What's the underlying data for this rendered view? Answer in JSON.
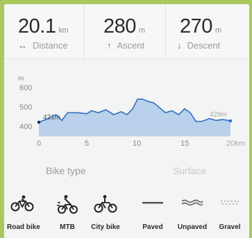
{
  "stats": {
    "distance": {
      "value": "20.1",
      "unit": "km",
      "label": "Distance",
      "icon": "↔"
    },
    "ascent": {
      "value": "280",
      "unit": "m",
      "label": "Ascent",
      "icon": "↑"
    },
    "descent": {
      "value": "270",
      "unit": "m",
      "label": "Descent",
      "icon": "↓"
    }
  },
  "chart_data": {
    "type": "area",
    "ylabel": "m",
    "xlim": [
      0,
      20
    ],
    "ylim": [
      350,
      650
    ],
    "yticks": [
      "600",
      "500",
      "400"
    ],
    "xticks": [
      "0",
      "5",
      "10",
      "15",
      "20km"
    ],
    "start_label": "421m",
    "end_label": "428m",
    "x": [
      0,
      1,
      1.8,
      2.4,
      3.0,
      4.0,
      5.0,
      5.5,
      6.2,
      7.0,
      7.8,
      8.6,
      9.2,
      9.8,
      10.3,
      10.8,
      11.3,
      12.0,
      12.5,
      13.2,
      13.9,
      14.6,
      15.2,
      15.8,
      16.4,
      17.0,
      17.8,
      18.5,
      19.2,
      20.0
    ],
    "y": [
      421,
      440,
      460,
      430,
      470,
      470,
      465,
      480,
      470,
      485,
      460,
      475,
      460,
      490,
      540,
      540,
      530,
      520,
      500,
      470,
      480,
      460,
      490,
      470,
      425,
      425,
      440,
      430,
      435,
      428
    ],
    "colors": {
      "line": "#2d6fc0",
      "fill": "#b9d1ea",
      "marker": "#1e2a4a"
    }
  },
  "sections": {
    "bike_type": "Bike type",
    "surface": "Surface"
  },
  "bike_types": [
    {
      "label": "Road bike",
      "icon": "road-bike-icon"
    },
    {
      "label": "MTB",
      "icon": "mtb-icon"
    },
    {
      "label": "City bike",
      "icon": "city-bike-icon"
    }
  ],
  "surfaces": [
    {
      "label": "Paved",
      "icon": "paved-icon"
    },
    {
      "label": "Unpaved",
      "icon": "unpaved-icon"
    },
    {
      "label": "Gravel",
      "icon": "gravel-icon"
    }
  ]
}
